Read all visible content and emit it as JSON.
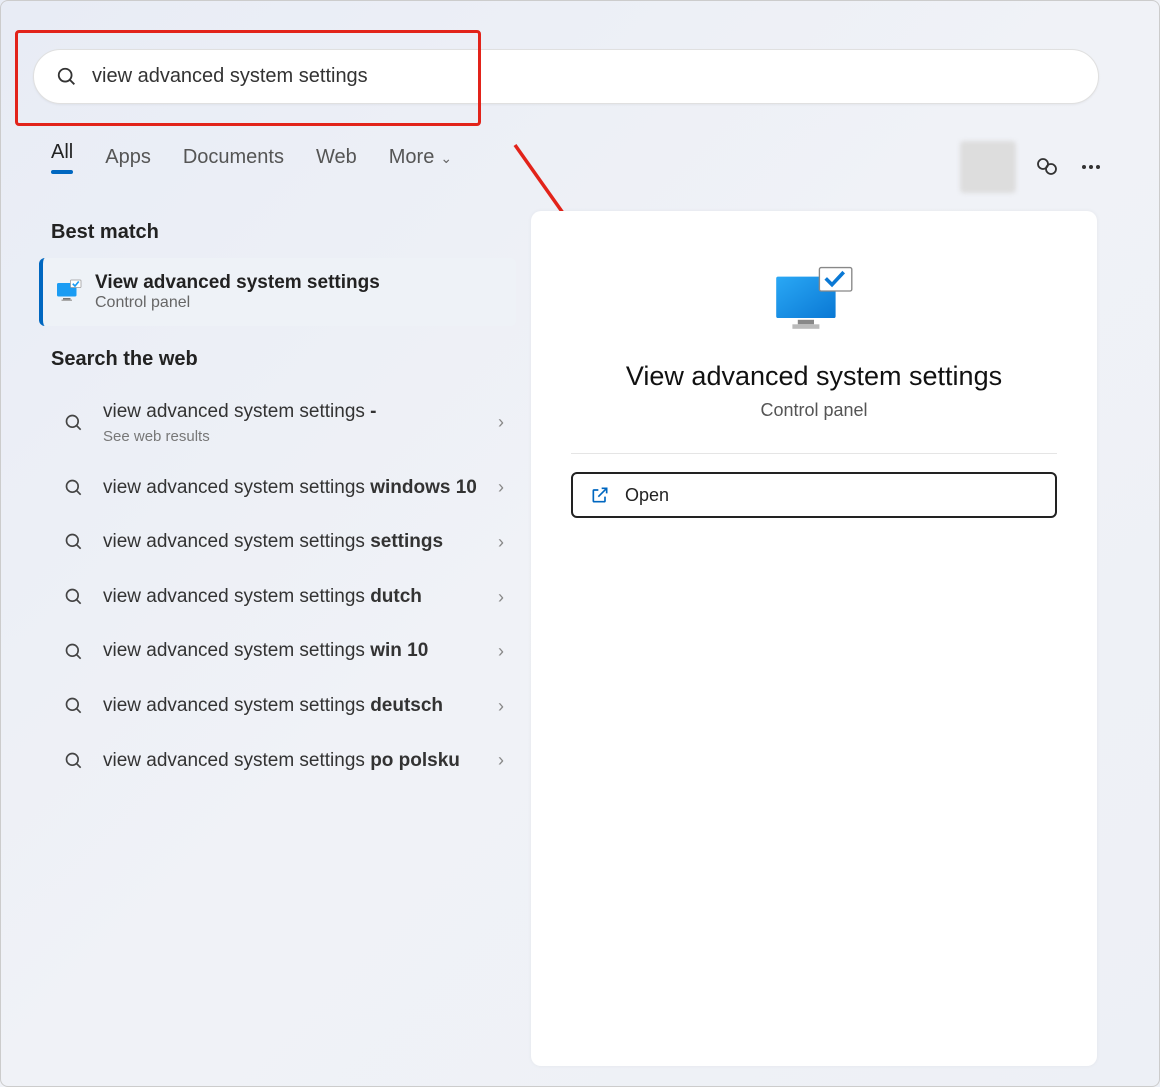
{
  "search": {
    "query": "view advanced system settings"
  },
  "tabs": {
    "all": "All",
    "apps": "Apps",
    "documents": "Documents",
    "web": "Web",
    "more": "More"
  },
  "best_match": {
    "header": "Best match",
    "title": "View advanced system settings",
    "subtitle": "Control panel"
  },
  "web_search": {
    "header": "Search the web",
    "items": [
      {
        "base": "view advanced system settings",
        "bold": " - ",
        "sub": "See web results"
      },
      {
        "base": "view advanced system settings ",
        "bold": "windows 10"
      },
      {
        "base": "view advanced system settings ",
        "bold": "settings"
      },
      {
        "base": "view advanced system settings ",
        "bold": "dutch"
      },
      {
        "base": "view advanced system settings ",
        "bold": "win 10"
      },
      {
        "base": "view advanced system settings ",
        "bold": "deutsch"
      },
      {
        "base": "view advanced system settings ",
        "bold": "po polsku"
      }
    ]
  },
  "details": {
    "title": "View advanced system settings",
    "subtitle": "Control panel",
    "open_label": "Open"
  }
}
